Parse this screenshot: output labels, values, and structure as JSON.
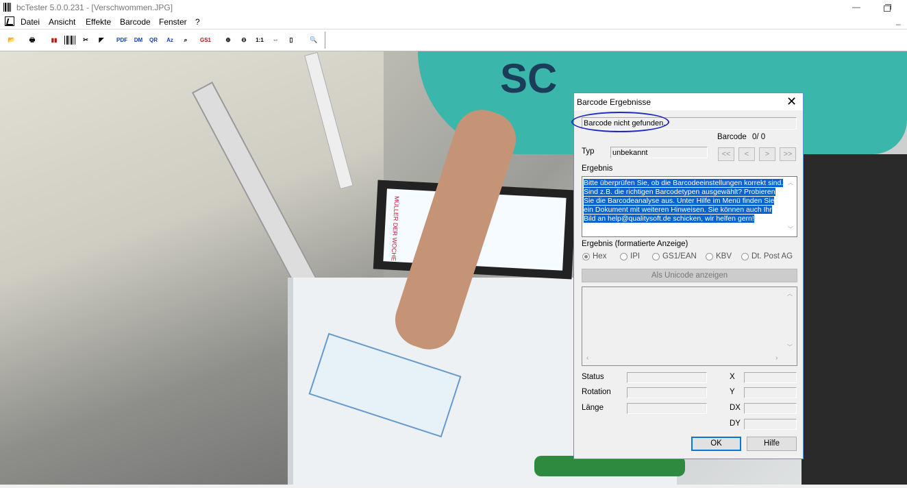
{
  "window": {
    "title": "bcTester 5.0.0.231 - [Verschwommen.JPG]",
    "minimize": "—"
  },
  "menu": {
    "items": [
      "Datei",
      "Ansicht",
      "Effekte",
      "Barcode",
      "Fenster",
      "?"
    ],
    "mdi_minimize": "_"
  },
  "toolbar": {
    "buttons": [
      {
        "name": "open-icon",
        "glyph": "📂"
      },
      {
        "name": "print-icon",
        "glyph": "🖶"
      },
      {
        "name": "barcode-red-icon",
        "glyph": "▮▮"
      },
      {
        "name": "barcode-icon",
        "glyph": ""
      },
      {
        "name": "barcode-scissors-icon",
        "glyph": "✂"
      },
      {
        "name": "contrast-icon",
        "glyph": "◤"
      },
      {
        "name": "pdf-icon",
        "glyph": "PDF"
      },
      {
        "name": "dm-icon",
        "glyph": "DM"
      },
      {
        "name": "qr-icon",
        "glyph": "QR"
      },
      {
        "name": "aztec-icon",
        "glyph": "Az"
      },
      {
        "name": "barcode-search-icon",
        "glyph": "⌕"
      },
      {
        "name": "gs1-icon",
        "glyph": "GS1"
      },
      {
        "name": "zoom-in-icon",
        "glyph": "⊕"
      },
      {
        "name": "zoom-out-icon",
        "glyph": "⊖"
      },
      {
        "name": "zoom-1to1-icon",
        "glyph": "1:1"
      },
      {
        "name": "fit-icon",
        "glyph": "⇔"
      },
      {
        "name": "page-icon",
        "glyph": "▯"
      },
      {
        "name": "preview-icon",
        "glyph": "🔍"
      }
    ]
  },
  "image": {
    "screen_text": "MÜLLER DER WOCHE",
    "shirt_text": "SC"
  },
  "dialog": {
    "title": "Barcode Ergebnisse",
    "close": "✕",
    "status_message": "Barcode nicht gefunden.",
    "barcode_label": "Barcode",
    "barcode_count": "0/ 0",
    "typ_label": "Typ",
    "typ_value": "unbekannt",
    "nav": [
      "<<",
      "<",
      ">",
      ">>"
    ],
    "ergebnis_label": "Ergebnis",
    "ergebnis_text": "Bitte überprüfen Sie, ob die Barcodeeinstellungen korrekt sind. Sind z.B. die richtigen Barcodetypen ausgewählt? Probieren Sie die Barcodeanalyse aus. Unter Hilfe im Menü finden Sie ein Dokument mit weiteren Hinweisen. Sie können auch Ihr Bild an help@qualitysoft.de schicken, wir helfen gern!",
    "formatted_label": "Ergebnis (formatierte Anzeige)",
    "formats": [
      "Hex",
      "IPI",
      "GS1/EAN",
      "KBV",
      "Dt. Post AG"
    ],
    "selected_format": "Hex",
    "unicode_button": "Als Unicode anzeigen",
    "fields_left": [
      "Status",
      "Rotation",
      "Länge"
    ],
    "fields_right": [
      "X",
      "Y",
      "DX",
      "DY"
    ],
    "ok": "OK",
    "help": "Hilfe"
  },
  "colors": {
    "accent": "#0078d7",
    "selection": "#0a64d0",
    "annotation": "#1f28c4"
  }
}
